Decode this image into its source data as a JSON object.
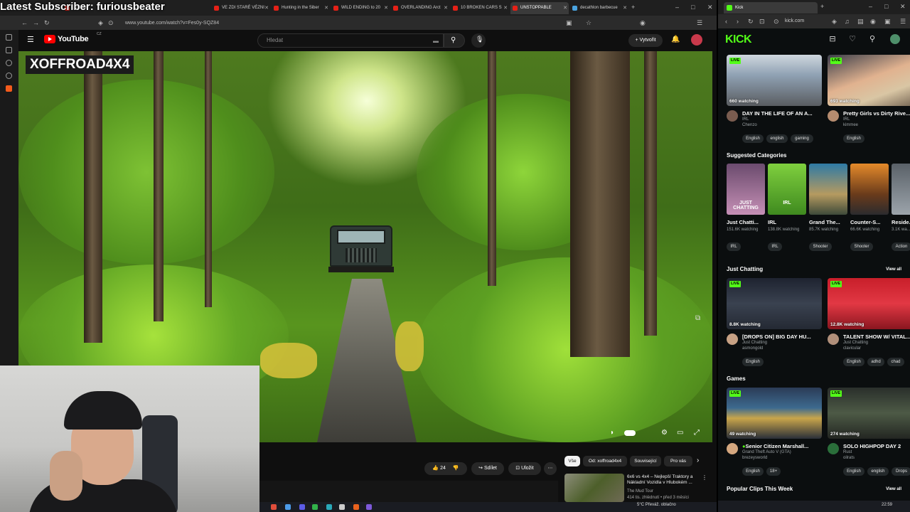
{
  "stream_overlay": "Latest Subscriber: furiousbeater",
  "youtube_browser": {
    "tabs": [
      {
        "label": "Latest Subscriber: furiousbeater",
        "active": false
      },
      {
        "label": "...illegal",
        "active": false
      },
      {
        "label": "VE ZDI STARÉ VÉZNI",
        "active": false
      },
      {
        "label": "Hunting in the Siber",
        "active": false
      },
      {
        "label": "WILD ENDING to 20",
        "active": false
      },
      {
        "label": "OVERLANDING Arct",
        "active": false
      },
      {
        "label": "10 BROKEN CARS S",
        "active": false
      },
      {
        "label": "UNSTOPPABLE",
        "active": true
      },
      {
        "label": "decathlon barbecue",
        "active": false
      }
    ],
    "url": "www.youtube.com/watch?v=Fes0y-SQZ84",
    "logo_text": "YouTube",
    "country_code": "CZ",
    "search_placeholder": "Hledat",
    "create_label": "Vytvořit",
    "video": {
      "watermark": "XOFFROAD4X4"
    },
    "actions": {
      "likes": "24",
      "share_label": "Sdílet",
      "save_label": "Uložit"
    },
    "chips": [
      "Vše",
      "Od: xoffroad4x4",
      "Související",
      "Pro vás"
    ],
    "recommended": {
      "title": "6x6 vs 4x4 – Nejlepší Traktory a Nákladní Vozidla v Hlubokém ...",
      "channel": "The Mud Tour",
      "meta": "414 tis. zhlédnutí • před 3 měsíci"
    },
    "taskbar_weather": "5°C Převáž. oblačno",
    "taskbar_time": "22:59"
  },
  "kick_browser": {
    "tab_label": "Kick",
    "url": "kick.com",
    "logo": "KICK",
    "live_badge": "LIVE",
    "top_streams": [
      {
        "viewers": "660 watching",
        "title": "DAY IN THE LIFE OF AN A...",
        "category": "IRL",
        "user": "Chenzo",
        "tags": [
          "English",
          "english",
          "gaming"
        ]
      },
      {
        "viewers": "693 watching",
        "title": "Pretty Girls vs Dirty Rive...",
        "category": "IRL",
        "user": "kimmee",
        "tags": [
          "English"
        ]
      }
    ],
    "suggested_title": "Suggested Categories",
    "categories": [
      {
        "name": "Just Chatti...",
        "viewers": "151.6K watching",
        "tag": "IRL",
        "img_label": "JUST CHATTING"
      },
      {
        "name": "IRL",
        "viewers": "138.8K watching",
        "tag": "IRL",
        "img_label": "IRL"
      },
      {
        "name": "Grand The...",
        "viewers": "85.7K watching",
        "tag": "Shooter",
        "img_label": ""
      },
      {
        "name": "Counter-S...",
        "viewers": "66.6K watching",
        "tag": "Shooter",
        "img_label": ""
      },
      {
        "name": "Reside...",
        "viewers": "3.1K wa...",
        "tag": "Action",
        "img_label": ""
      }
    ],
    "just_chatting_title": "Just Chatting",
    "view_all": "View all",
    "just_chatting_streams": [
      {
        "viewers": "8.8K watching",
        "title": "[DROPS ON] BIG DAY HU...",
        "category": "Just Chatting",
        "user": "asmongold",
        "tags": [
          "English"
        ]
      },
      {
        "viewers": "12.8K watching",
        "title": "TALENT SHOW W/ VITAL...",
        "category": "Just Chatting",
        "user": "clavicular",
        "tags": [
          "English",
          "adhd",
          "chad"
        ]
      }
    ],
    "games_title": "Games",
    "games_streams": [
      {
        "viewers": "49 watching",
        "title": "Senior Citizen Marshall...",
        "category": "Grand Theft Auto V (GTA)",
        "user": "brezeysworld",
        "tags": [
          "English",
          "18+"
        ]
      },
      {
        "viewers": "274 watching",
        "title": "SOLO HIGHPOP DAY 2",
        "category": "Rust",
        "user": "oilrats",
        "tags": [
          "English",
          "english",
          "Drops"
        ]
      }
    ],
    "popular_clips_title": "Popular Clips This Week"
  }
}
